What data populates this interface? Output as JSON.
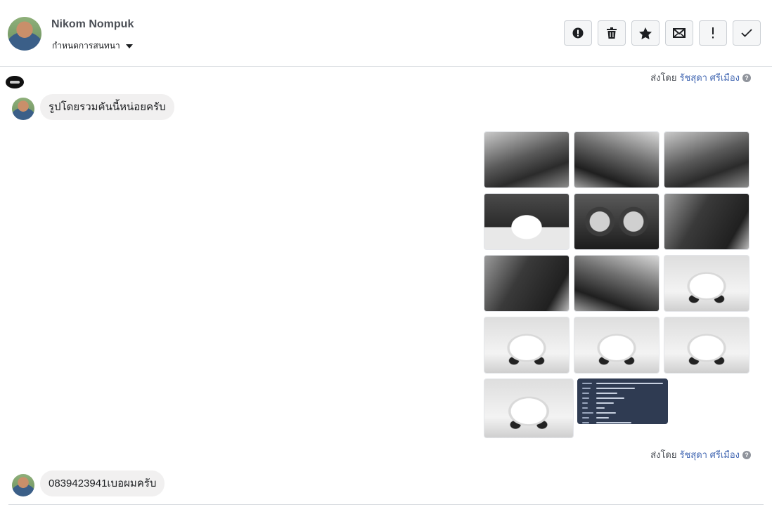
{
  "header": {
    "user_name": "Nikom Nompuk",
    "assign_label": "กำหนดการสนทนา",
    "toolbar": [
      {
        "name": "report-button",
        "icon": "alert-circle-icon"
      },
      {
        "name": "delete-button",
        "icon": "trash-icon"
      },
      {
        "name": "star-button",
        "icon": "star-icon"
      },
      {
        "name": "mark-unread-button",
        "icon": "envelope-icon"
      },
      {
        "name": "important-button",
        "icon": "exclamation-icon"
      },
      {
        "name": "done-button",
        "icon": "check-icon"
      }
    ]
  },
  "attribution": {
    "prefix": "ส่งโดย",
    "agent": "รัชสุดา ศรีเมือง",
    "help_icon": "question-icon"
  },
  "messages": [
    {
      "text": "รูปโดยรวมคันนี้หน่อยครับ"
    },
    {
      "text": "0839423941เบอผมครับ"
    }
  ],
  "photos": [
    {
      "kind": "interior"
    },
    {
      "kind": "interior2"
    },
    {
      "kind": "interior"
    },
    {
      "kind": "engine"
    },
    {
      "kind": "gauge"
    },
    {
      "kind": "seat"
    },
    {
      "kind": "seat"
    },
    {
      "kind": "interior2"
    },
    {
      "kind": "truck"
    },
    {
      "kind": "truck"
    },
    {
      "kind": "truck"
    },
    {
      "kind": "truck"
    },
    {
      "kind": "truck"
    },
    {
      "kind": "doc"
    }
  ],
  "colors": {
    "bubble_bg": "#f1f0f0",
    "link": "#4267b2",
    "border": "#dadde1"
  }
}
